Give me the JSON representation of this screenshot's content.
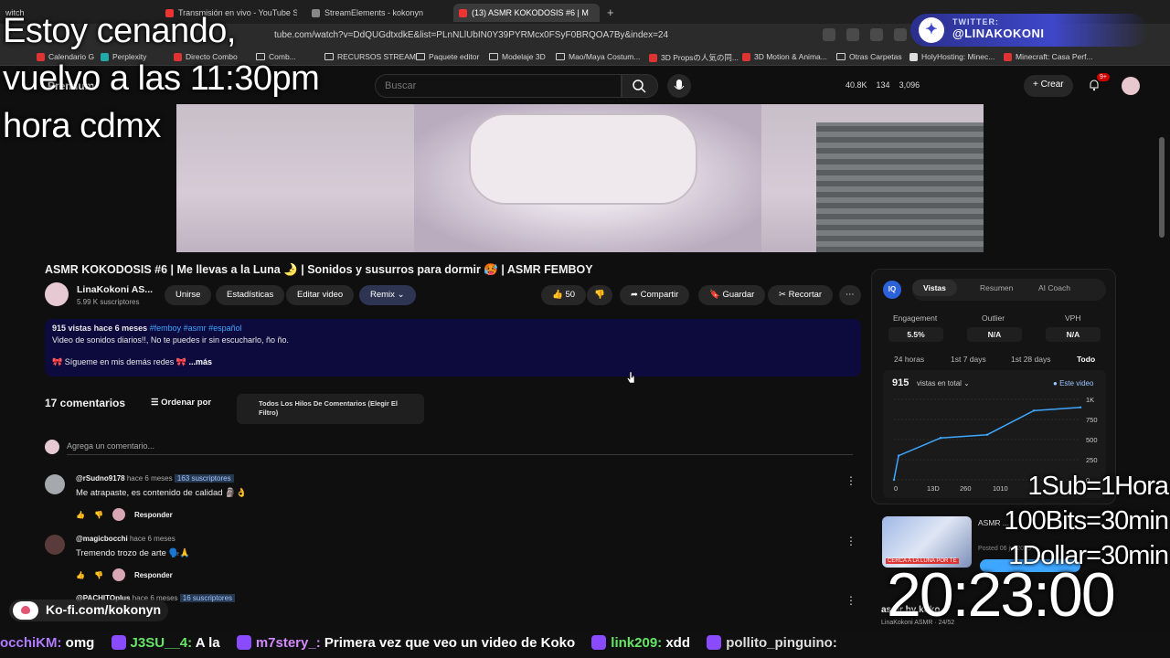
{
  "browser": {
    "tabs": [
      {
        "label": "witch"
      },
      {
        "label": "Transmisión en vivo - YouTube Studio"
      },
      {
        "label": "StreamElements - kokonyn"
      },
      {
        "label": "(13) ASMR KOKODOSIS #6 | M"
      }
    ],
    "url": "tube.com/watch?v=DdQUGdtxdkE&list=PLnNLlUbIN0Y39PYRMcx0FSyF0BRQOA7By&index=24",
    "bookmarks": [
      "Calendario G",
      "Perplexity",
      "Directo Combo",
      "Comb...",
      "RECURSOS STREAM",
      "Paquete editor",
      "Modelaje 3D",
      "Mao/Maya Costum...",
      "3D Propsの人気の同...",
      "3D Motion & Anima...",
      "Otras Carpetas",
      "HolyHosting: Minec...",
      "Minecraft: Casa Perf..."
    ]
  },
  "youtube": {
    "logo": "Premium",
    "search_placeholder": "Buscar",
    "stats": [
      "40.8K",
      "134",
      "3,096"
    ],
    "create_label": "Crear",
    "notif_badge": "9+"
  },
  "video": {
    "title": "ASMR KOKODOSIS #6 | Me llevas a la Luna 🌛 | Sonidos y susurros para dormir 🥵 | ASMR FEMBOY",
    "channel_name": "LinaKokoni AS...",
    "channel_subs": "5.99 K suscriptores",
    "buttons": {
      "join": "Unirse",
      "stats": "Estadísticas",
      "edit": "Editar video",
      "remix": "Remix",
      "likes": "50",
      "share": "Compartir",
      "save": "Guardar",
      "clip": "Recortar"
    },
    "description": {
      "views": "915 vistas",
      "when": "hace 6 meses",
      "tags": "#femboy #asmr #español",
      "line1": "Video de sonidos diarios!!, No te puedes ir sin escucharlo, ño ño.",
      "line2": "🎀 Sígueme en mis demás redes 🎀",
      "more": "...más"
    }
  },
  "comments": {
    "count_label": "17 comentarios",
    "sort_label": "Ordenar por",
    "filter_label": "Todos Los Hilos De Comentarios (Elegir El Filtro)",
    "add_placeholder": "Agrega un comentario...",
    "reply_label": "Responder",
    "items": [
      {
        "user": "@rSudno9178",
        "when": "hace 6 meses",
        "subs": "163 suscriptores",
        "text": "Me atrapaste, es contenido de calidad 🗿👌"
      },
      {
        "user": "@magicbocchi",
        "when": "hace 6 meses",
        "subs": "",
        "text": "Tremendo trozo de arte 🗣️🙏"
      },
      {
        "user": "@PACHITOplus",
        "when": "hace 6 meses",
        "subs": "16 suscriptores",
        "text": ""
      }
    ]
  },
  "panel": {
    "tabs": [
      "Vistas",
      "Resumen",
      "AI Coach"
    ],
    "metrics": [
      {
        "label": "Engagement",
        "value": "5.5%"
      },
      {
        "label": "Outlier",
        "value": "N/A"
      },
      {
        "label": "VPH",
        "value": "N/A"
      }
    ],
    "ranges": [
      "24 horas",
      "1st 7 days",
      "1st 28 days",
      "Todo"
    ],
    "total_views": "915",
    "total_label": "vistas en total",
    "legend": "Este video"
  },
  "chart_data": {
    "type": "line",
    "x": [
      0,
      13,
      130,
      260,
      390,
      520
    ],
    "series": [
      {
        "name": "Este video",
        "values": [
          0,
          300,
          520,
          560,
          860,
          900
        ]
      }
    ],
    "yticks": [
      "1K",
      "750",
      "500",
      "250",
      "0"
    ],
    "xticks": [
      "0",
      "13D",
      "260",
      "1010"
    ],
    "ylim": [
      0,
      1000
    ]
  },
  "recommended": {
    "thumb_caption": "CERCA A LA LUNA POR TE",
    "title": "ASMR ... ",
    "date": "Posted 06 jul 2025",
    "playlist": "asmr by koko",
    "playlist_sub": "LinaKokoni ASMR · 24/52"
  },
  "overlay": {
    "message_lines": [
      "Estoy cenando,",
      "vuelvo a las 11:30pm",
      "hora cdmx"
    ],
    "twitter_label": "TWITTER:",
    "twitter_handle": "@LINAKOKONI",
    "goals": [
      "1Sub=1Hora",
      "100Bits=30min",
      "1Dollar=30min"
    ],
    "timer": "20:23:00",
    "kofi": "Ko-fi.com/kokonyn",
    "chat": [
      {
        "user": "occhiKM:",
        "msg": "omg"
      },
      {
        "user": "J3SU__4:",
        "msg": "A la"
      },
      {
        "user": "m7stery_:",
        "msg": "Primera vez que veo un video de Koko"
      },
      {
        "user": "link209:",
        "msg": "xdd"
      },
      {
        "user": "pollito_pinguino:",
        "msg": ""
      }
    ]
  }
}
